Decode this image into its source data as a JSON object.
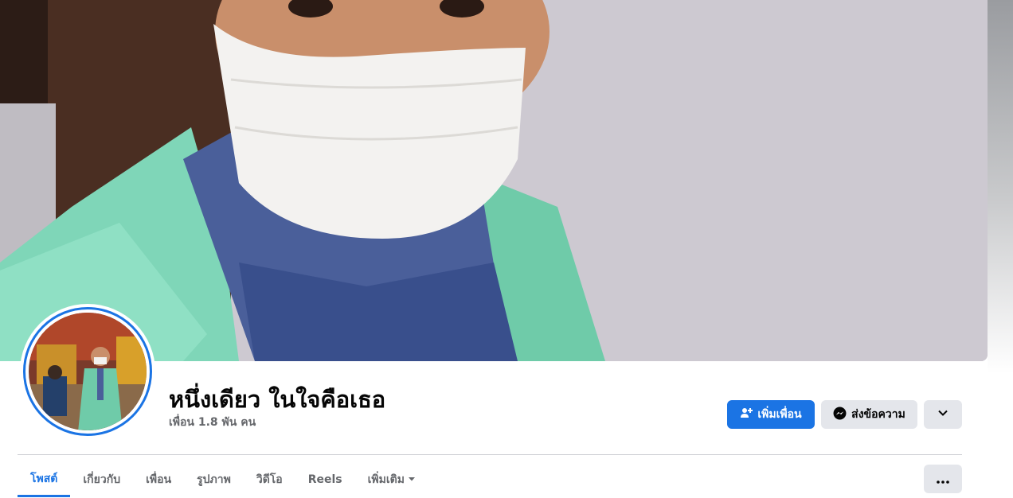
{
  "profile": {
    "name": "หนึ่งเดียว ในใจคือเธอ",
    "friends_count": "เพื่อน 1.8 พัน คน"
  },
  "actions": {
    "add_friend_label": "เพิ่มเพื่อน",
    "message_label": "ส่งข้อความ"
  },
  "tabs": [
    {
      "label": "โพสต์",
      "active": true
    },
    {
      "label": "เกี่ยวกับ",
      "active": false
    },
    {
      "label": "เพื่อน",
      "active": false
    },
    {
      "label": "รูปภาพ",
      "active": false
    },
    {
      "label": "วิดีโอ",
      "active": false
    },
    {
      "label": "Reels",
      "active": false
    },
    {
      "label": "เพิ่มเติม",
      "active": false
    }
  ],
  "icons": {
    "add_friend": "person-plus-icon",
    "message": "messenger-icon",
    "dropdown": "chevron-down-icon",
    "more": "ellipsis-icon",
    "tab_more": "caret-down-icon"
  },
  "colors": {
    "primary": "#1b74e4",
    "secondary_bg": "#e4e6eb",
    "text": "#050505",
    "muted_text": "#65676b"
  }
}
